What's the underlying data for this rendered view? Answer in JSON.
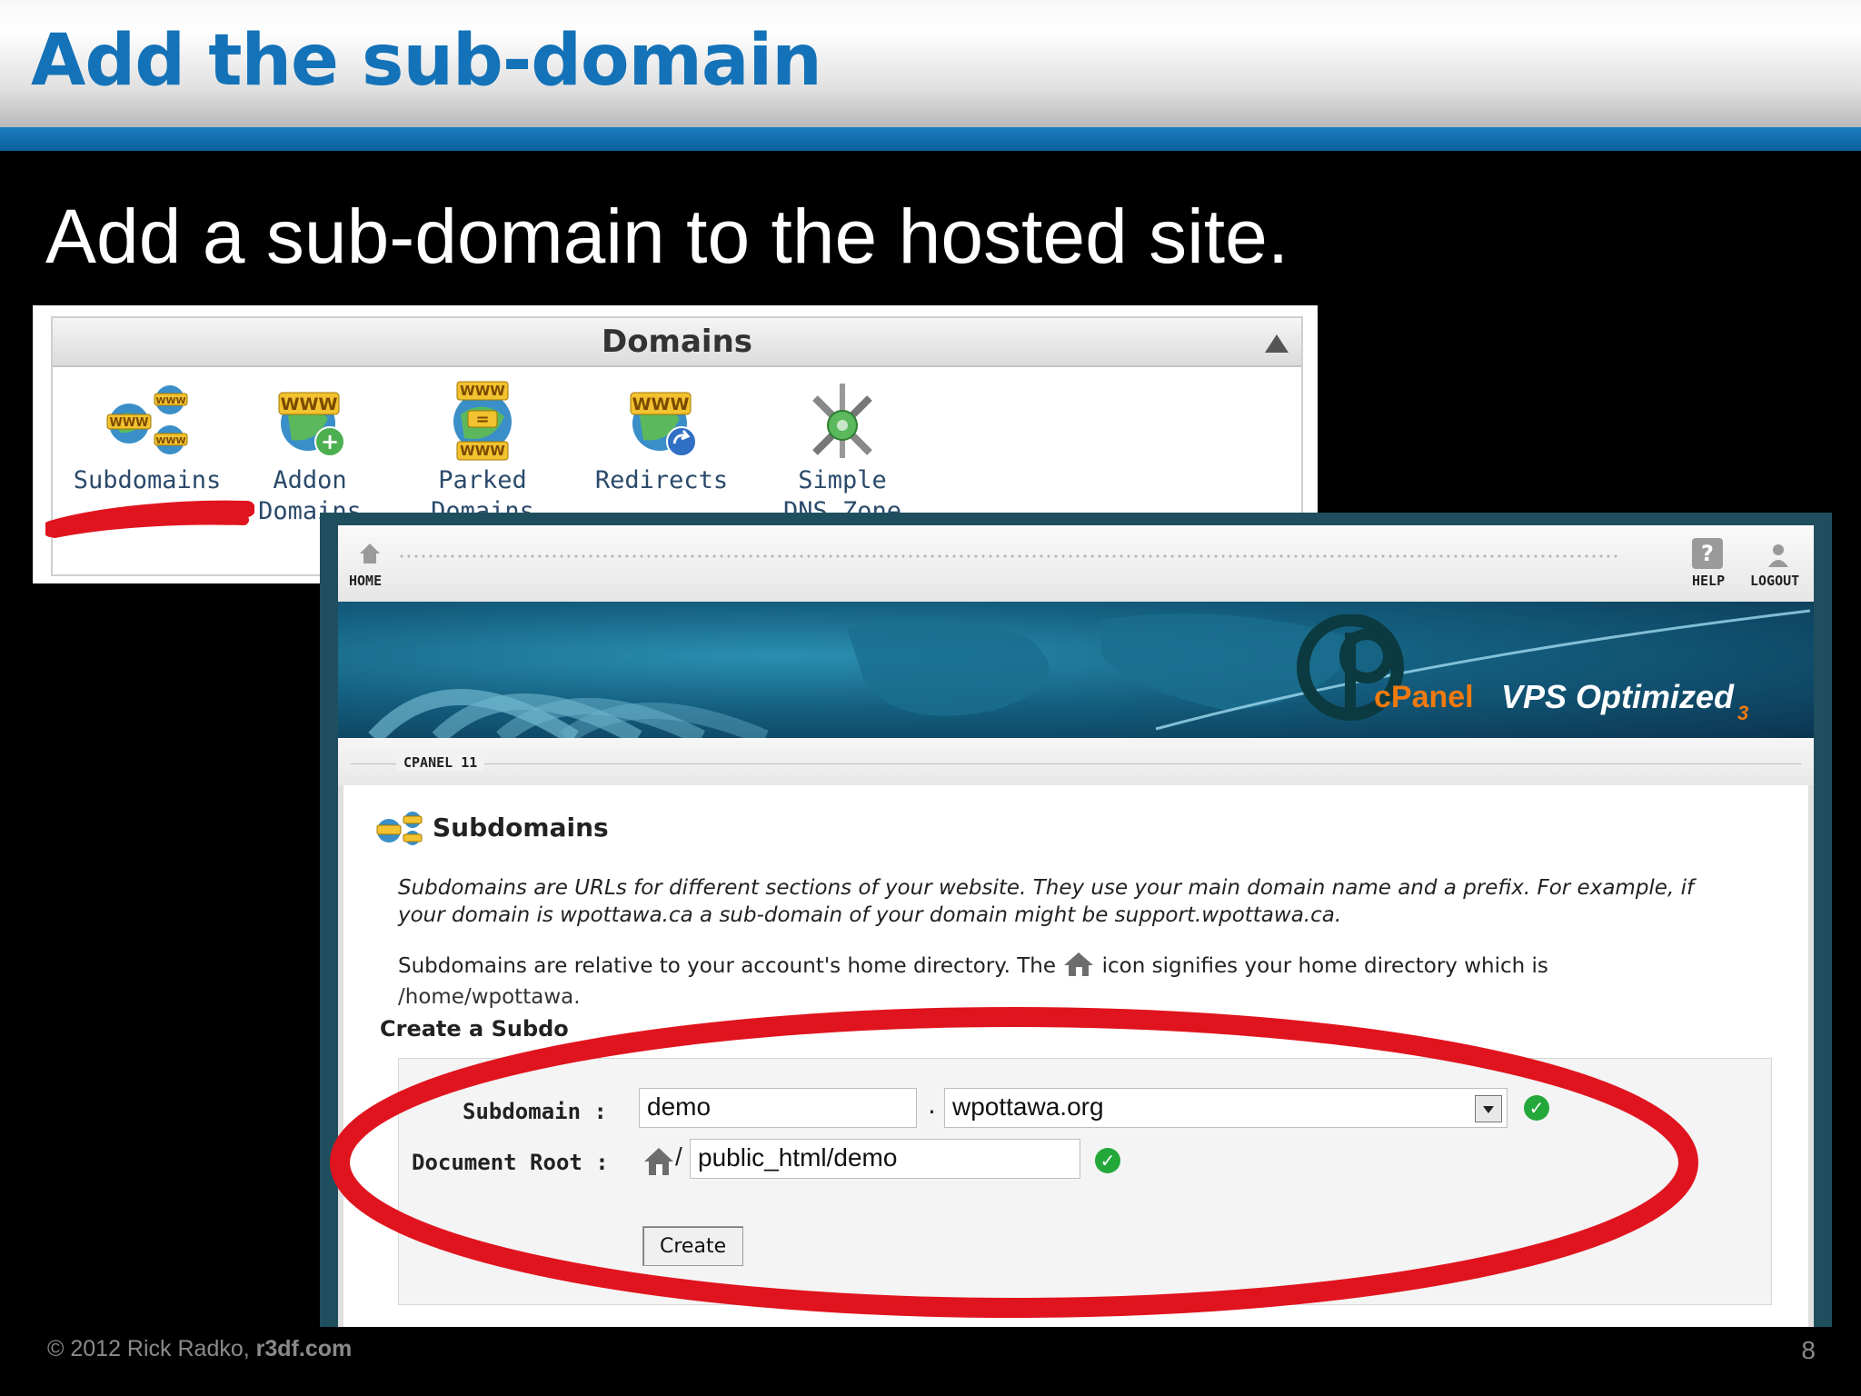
{
  "slide": {
    "title": "Add the sub-domain",
    "subtitle": "Add a sub-domain to the hosted site.",
    "footer_copyright": "© 2012  Rick Radko, ",
    "footer_site": "r3df.com",
    "page_number": "8"
  },
  "domains_panel": {
    "title": "Domains",
    "items": [
      {
        "label_line1": "Subdomains",
        "label_line2": "",
        "icon": "subdomains-icon"
      },
      {
        "label_line1": "Addon",
        "label_line2": "Domains",
        "icon": "addon-domains-icon"
      },
      {
        "label_line1": "Parked",
        "label_line2": "Domains",
        "icon": "parked-domains-icon"
      },
      {
        "label_line1": "Redirects",
        "label_line2": "",
        "icon": "redirects-icon"
      },
      {
        "label_line1": "Simple",
        "label_line2": "DNS Zone",
        "icon": "dns-zone-icon"
      }
    ]
  },
  "cpanel": {
    "toolbar": {
      "home": "HOME",
      "help": "HELP",
      "logout": "LOGOUT"
    },
    "banner": {
      "brand": "cPanel",
      "product": "VPS Optimized",
      "version": "3"
    },
    "breadcrumb": "CPANEL 11",
    "section_title": "Subdomains",
    "desc_line1": "Subdomains are URLs for different sections of your website. They use your main domain name and a prefix. For example, if",
    "desc_line2": "your domain is wpottawa.ca a sub-domain of your domain might be support.wpottawa.ca.",
    "rel_line1_a": "Subdomains are relative to your account's home directory. The ",
    "rel_line1_b": " icon signifies your home directory which is",
    "rel_line2": "/home/wpottawa.",
    "create_title": "Create a Subdo",
    "form": {
      "subdomain_label": "Subdomain :",
      "subdomain_value": "demo",
      "dot": ".",
      "domain_value": "wpottawa.org",
      "docroot_label": "Document Root :",
      "docroot_slash": "/",
      "docroot_value": "public_html/demo",
      "create_button": "Create"
    }
  },
  "colors": {
    "title_blue": "#1472b8",
    "accent_red": "#e0141e",
    "ok_green": "#24a83a"
  }
}
